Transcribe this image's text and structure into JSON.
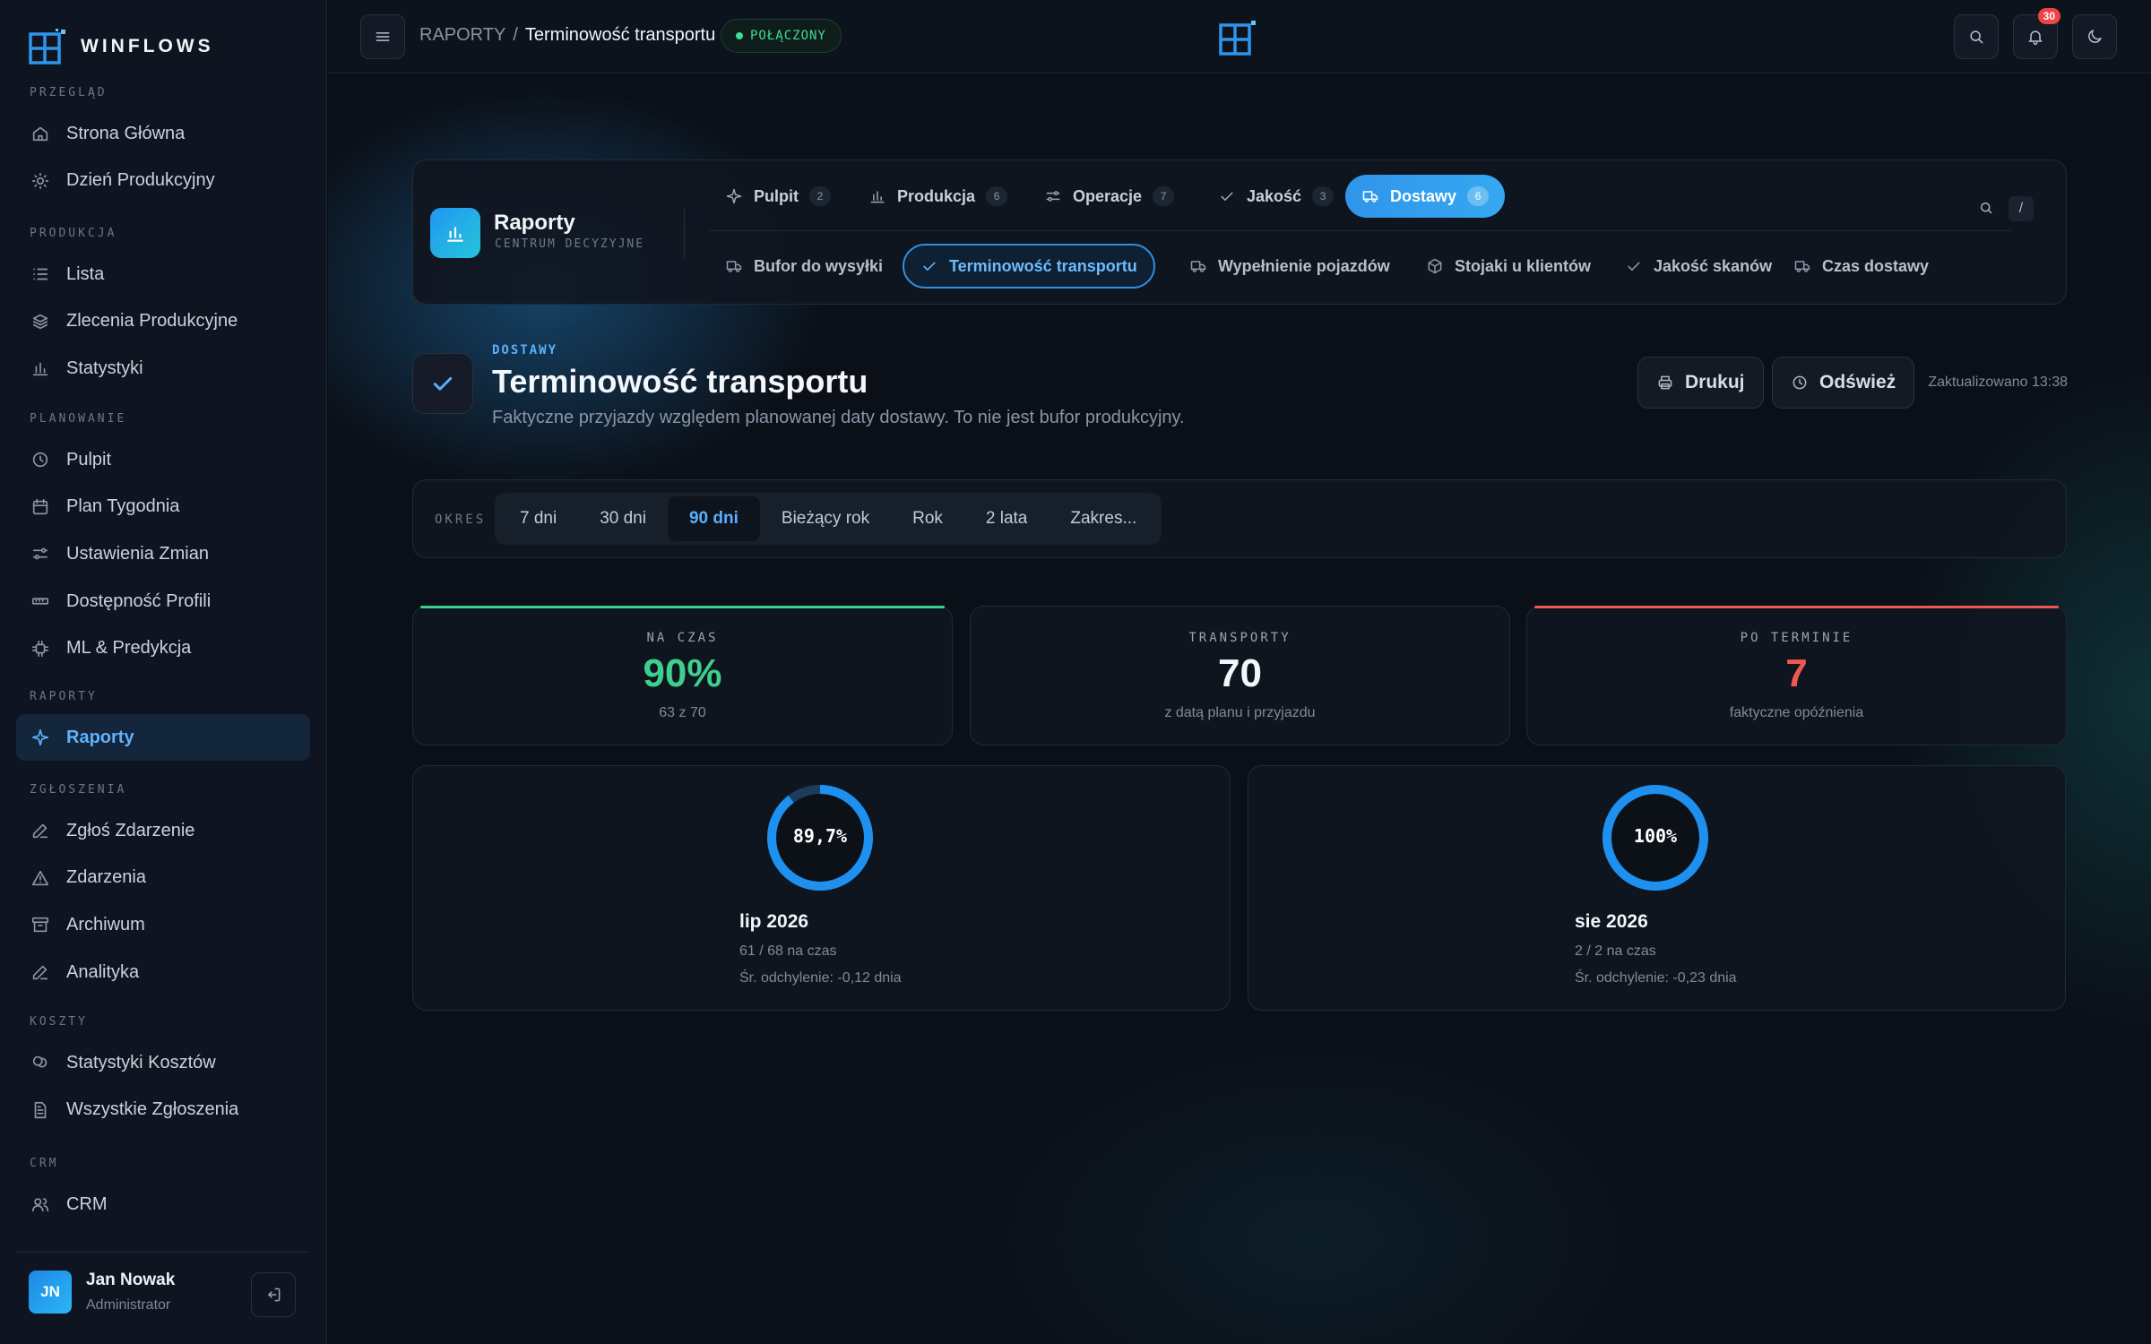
{
  "brand": {
    "name": "WINFLOWS"
  },
  "sidebar": {
    "sections": [
      {
        "title": "PRZEGLĄD",
        "items": [
          {
            "label": "Strona Główna",
            "icon": "home-icon"
          },
          {
            "label": "Dzień Produkcyjny",
            "icon": "sun-icon"
          }
        ]
      },
      {
        "title": "PRODUKCJA",
        "items": [
          {
            "label": "Lista",
            "icon": "list-icon"
          },
          {
            "label": "Zlecenia Produkcyjne",
            "icon": "layers-icon"
          },
          {
            "label": "Statystyki",
            "icon": "bar-chart-icon"
          }
        ]
      },
      {
        "title": "PLANOWANIE",
        "items": [
          {
            "label": "Pulpit",
            "icon": "clock-icon"
          },
          {
            "label": "Plan Tygodnia",
            "icon": "calendar-icon"
          },
          {
            "label": "Ustawienia Zmian",
            "icon": "sliders-icon"
          },
          {
            "label": "Dostępność Profili",
            "icon": "ruler-icon"
          },
          {
            "label": "ML & Predykcja",
            "icon": "chip-icon"
          }
        ]
      },
      {
        "title": "RAPORTY",
        "items": [
          {
            "label": "Raporty",
            "icon": "sparkle-icon",
            "active": true
          }
        ]
      },
      {
        "title": "ZGŁOSZENIA",
        "items": [
          {
            "label": "Zgłoś Zdarzenie",
            "icon": "pencil-icon"
          },
          {
            "label": "Zdarzenia",
            "icon": "warning-icon"
          },
          {
            "label": "Archiwum",
            "icon": "archive-icon"
          },
          {
            "label": "Analityka",
            "icon": "pencil-icon"
          }
        ]
      },
      {
        "title": "KOSZTY",
        "items": [
          {
            "label": "Statystyki Kosztów",
            "icon": "coins-icon"
          },
          {
            "label": "Wszystkie Zgłoszenia",
            "icon": "file-icon"
          }
        ]
      },
      {
        "title": "CRM",
        "items": [
          {
            "label": "CRM",
            "icon": "users-icon"
          }
        ]
      }
    ],
    "user": {
      "initials": "JN",
      "name": "Jan Nowak",
      "role": "Administrator"
    }
  },
  "topbar": {
    "breadcrumb_root": "RAPORTY",
    "breadcrumb_sep": "/",
    "breadcrumb_current": "Terminowość transportu",
    "status": "POŁĄCZONY",
    "notifications": "30"
  },
  "reports": {
    "title": "Raporty",
    "subtitle": "CENTRUM DECYZYJNE",
    "search_key": "/",
    "tabs": [
      {
        "label": "Pulpit",
        "count": "2",
        "icon": "sparkle-icon"
      },
      {
        "label": "Produkcja",
        "count": "6",
        "icon": "bar-chart-icon"
      },
      {
        "label": "Operacje",
        "count": "7",
        "icon": "sliders-icon"
      },
      {
        "label": "Jakość",
        "count": "3",
        "icon": "check-icon"
      },
      {
        "label": "Dostawy",
        "count": "6",
        "icon": "truck-icon",
        "active": true
      }
    ],
    "subtabs": [
      {
        "label": "Bufor do wysyłki",
        "icon": "truck-icon"
      },
      {
        "label": "Terminowość transportu",
        "icon": "check-icon",
        "active": true
      },
      {
        "label": "Wypełnienie pojazdów",
        "icon": "truck-icon"
      },
      {
        "label": "Stojaki u klientów",
        "icon": "box-icon"
      },
      {
        "label": "Jakość skanów",
        "icon": "check-icon"
      },
      {
        "label": "Czas dostawy",
        "icon": "truck-icon"
      }
    ]
  },
  "page": {
    "eyebrow": "DOSTAWY",
    "title": "Terminowość transportu",
    "description": "Faktyczne przyjazdy względem planowanej daty dostawy. To nie jest bufor produkcyjny.",
    "print_label": "Drukuj",
    "refresh_label": "Odśwież",
    "updated": "Zaktualizowano 13:38"
  },
  "period": {
    "label": "OKRES",
    "options": [
      "7 dni",
      "30 dni",
      "90 dni",
      "Bieżący rok",
      "Rok",
      "2 lata",
      "Zakres..."
    ],
    "selected": "90 dni"
  },
  "kpis": [
    {
      "label": "NA CZAS",
      "value": "90%",
      "sub": "63 z 70",
      "color": "#3ecf8e",
      "accent": "#3ecf8e"
    },
    {
      "label": "TRANSPORTY",
      "value": "70",
      "sub": "z datą planu i przyjazdu",
      "color": "#f3f6fa",
      "accent": ""
    },
    {
      "label": "PO TERMINIE",
      "value": "7",
      "sub": "faktyczne opóźnienia",
      "color": "#f0584f",
      "accent": "#f0584f"
    }
  ],
  "months": [
    {
      "percent_label": "89,7%",
      "percent": 89.7,
      "title": "lip 2026",
      "line1": "61 / 68 na czas",
      "line2": "Śr. odchylenie: -0,12 dnia"
    },
    {
      "percent_label": "100%",
      "percent": 100,
      "title": "sie 2026",
      "line1": "2 / 2 na czas",
      "line2": "Śr. odchylenie: -0,23 dnia"
    }
  ],
  "colors": {
    "accent": "#2f95ea",
    "success": "#3ecf8e",
    "danger": "#f0584f",
    "ring": "#1e90f0"
  }
}
